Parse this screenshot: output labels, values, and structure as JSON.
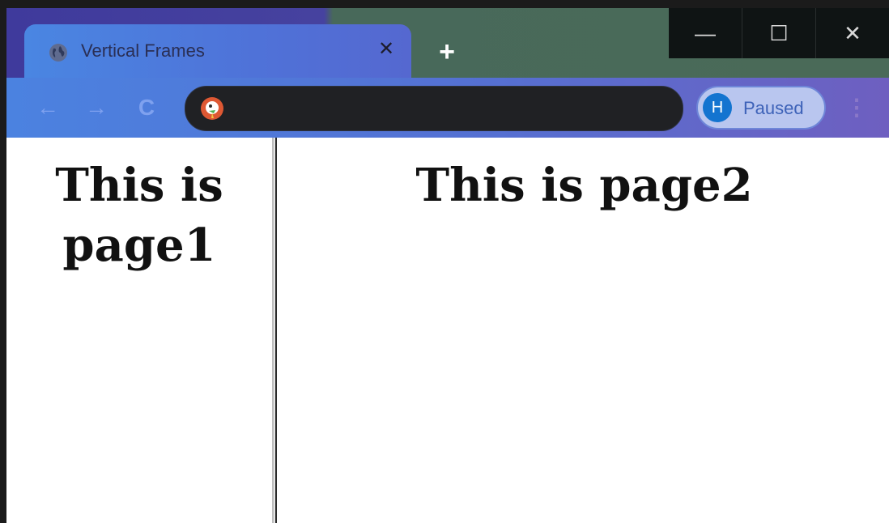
{
  "tab": {
    "title": "Vertical Frames",
    "favicon": "globe-icon",
    "close_glyph": "✕"
  },
  "new_tab_glyph": "+",
  "window_controls": {
    "minimize_glyph": "—",
    "maximize_glyph": "☐",
    "close_glyph": "✕"
  },
  "toolbar": {
    "back_glyph": "←",
    "forward_glyph": "→",
    "reload_glyph": "C",
    "search_engine_icon": "duckduckgo-icon",
    "address_value": "",
    "profile_initial": "H",
    "profile_status": "Paused",
    "menu_glyph": "⋮"
  },
  "frames": {
    "left_text": "This is page1",
    "right_text": "This is page2"
  },
  "colors": {
    "tab_accent": "#4a86e2",
    "profile_avatar": "#1374d0"
  }
}
